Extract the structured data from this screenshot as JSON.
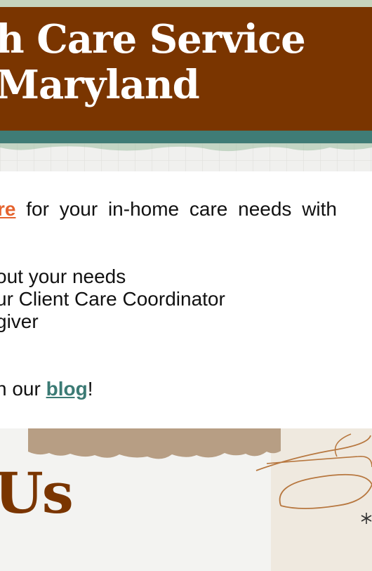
{
  "banner": {
    "line1": "h Care Service",
    "line2": "Maryland"
  },
  "content": {
    "first_line": {
      "link": "re",
      "text": " for your in-home care needs with"
    },
    "list": [
      "out your needs",
      "ur Client Care Coordinator",
      "giver"
    ],
    "blog_line": {
      "prefix": "n our ",
      "link": "blog",
      "suffix": "!"
    }
  },
  "collage": {
    "heading": "Us"
  },
  "colors": {
    "banner_brown": "#7a3500",
    "teal": "#3f7c76",
    "link_orange": "#e5632e",
    "link_teal": "#3b7a74",
    "kraft": "#b79e84"
  },
  "icons": [
    "scribble-decoration-icon",
    "asterisk-star-icon"
  ]
}
